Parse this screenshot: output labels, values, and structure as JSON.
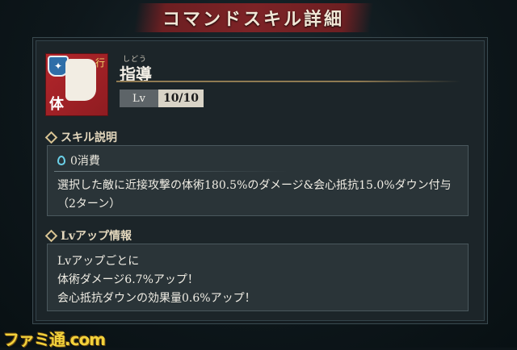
{
  "header": {
    "title": "コマンドスキル詳細"
  },
  "skill": {
    "icon_name": "fist-skill-icon",
    "type_badge": "体",
    "corner_mark": "行",
    "name_ruby": "しどう",
    "name": "指導",
    "level_label": "Lv",
    "level_value": "10/10"
  },
  "description_section": {
    "heading": "スキル説明",
    "cost": "0消費",
    "text": "選択した敵に近接攻撃の体術180.5%のダメージ&会心抵抗15.0%ダウン付与（2ターン）"
  },
  "levelup_section": {
    "heading": "Lvアップ情報",
    "lines": [
      "Lvアップごとに",
      "体術ダメージ6.7%アップ！",
      "会心抵抗ダウンの効果量0.6%アップ！"
    ]
  },
  "watermark": "ファミ通.com",
  "colors": {
    "banner": "#7d2326",
    "panel": "#1c2529",
    "accent_gold": "#d9c493",
    "icon_red": "#b3262b"
  }
}
